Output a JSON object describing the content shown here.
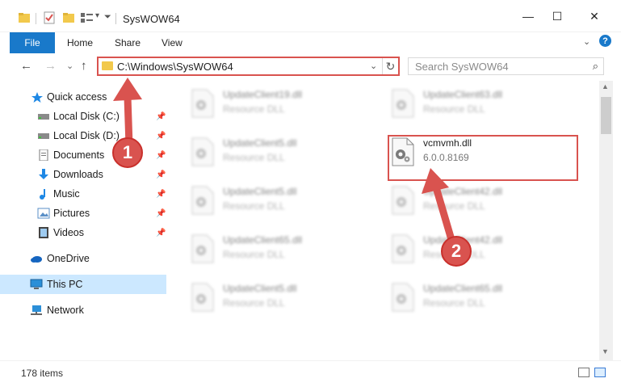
{
  "window": {
    "title": "SysWOW64",
    "minimize": "—",
    "maximize": "☐",
    "close": "✕"
  },
  "ribbon": {
    "tabs": [
      "File",
      "Home",
      "Share",
      "View"
    ],
    "expand": "⌄",
    "help": "?"
  },
  "nav": {
    "back": "←",
    "forward": "→",
    "recent": "⌄",
    "up": "↑"
  },
  "address": {
    "path": "C:\\Windows\\SysWOW64",
    "dropdown": "⌄",
    "refresh": "↻"
  },
  "search": {
    "placeholder": "Search SysWOW64",
    "icon": "⌕"
  },
  "sidebar": {
    "items": [
      {
        "label": "Quick access",
        "icon": "star-icon",
        "pinned": false
      },
      {
        "label": "Local Disk (C:)",
        "icon": "drive-icon",
        "pinned": true
      },
      {
        "label": "Local Disk (D:)",
        "icon": "drive-icon",
        "pinned": true
      },
      {
        "label": "Documents",
        "icon": "documents-icon",
        "pinned": true
      },
      {
        "label": "Downloads",
        "icon": "downloads-icon",
        "pinned": true
      },
      {
        "label": "Music",
        "icon": "music-icon",
        "pinned": true
      },
      {
        "label": "Pictures",
        "icon": "pictures-icon",
        "pinned": true
      },
      {
        "label": "Videos",
        "icon": "videos-icon",
        "pinned": true
      },
      {
        "label": "OneDrive",
        "icon": "cloud-icon",
        "pinned": false
      },
      {
        "label": "This PC",
        "icon": "computer-icon",
        "pinned": false,
        "selected": true
      },
      {
        "label": "Network",
        "icon": "network-icon",
        "pinned": false
      }
    ]
  },
  "files": {
    "left": [
      {
        "name": "UpdateClient19.dll",
        "desc": "Resource DLL"
      },
      {
        "name": "UpdateClient5.dll",
        "desc": "Resource DLL"
      },
      {
        "name": "UpdateClient5.dll",
        "desc": "Resource DLL"
      },
      {
        "name": "UpdateClient65.dll",
        "desc": "Resource DLL"
      },
      {
        "name": "UpdateClient5.dll",
        "desc": "Resource DLL"
      }
    ],
    "right": [
      {
        "name": "UpdateClient63.dll",
        "desc": "Resource DLL"
      },
      {
        "name": "vcmvmh.dll",
        "desc": "6.0.0.8169",
        "highlight": true
      },
      {
        "name": "UpdateClient42.dll",
        "desc": "Resource DLL"
      },
      {
        "name": "UpdateClient42.dll",
        "desc": "Resource DLL"
      },
      {
        "name": "UpdateClient65.dll",
        "desc": "Resource DLL"
      }
    ]
  },
  "status": {
    "count": "178 items"
  },
  "annotations": {
    "step1": "1",
    "step2": "2"
  },
  "colors": {
    "accent": "#1979ca",
    "annotation": "#d9534f",
    "selected": "#cce8ff"
  }
}
